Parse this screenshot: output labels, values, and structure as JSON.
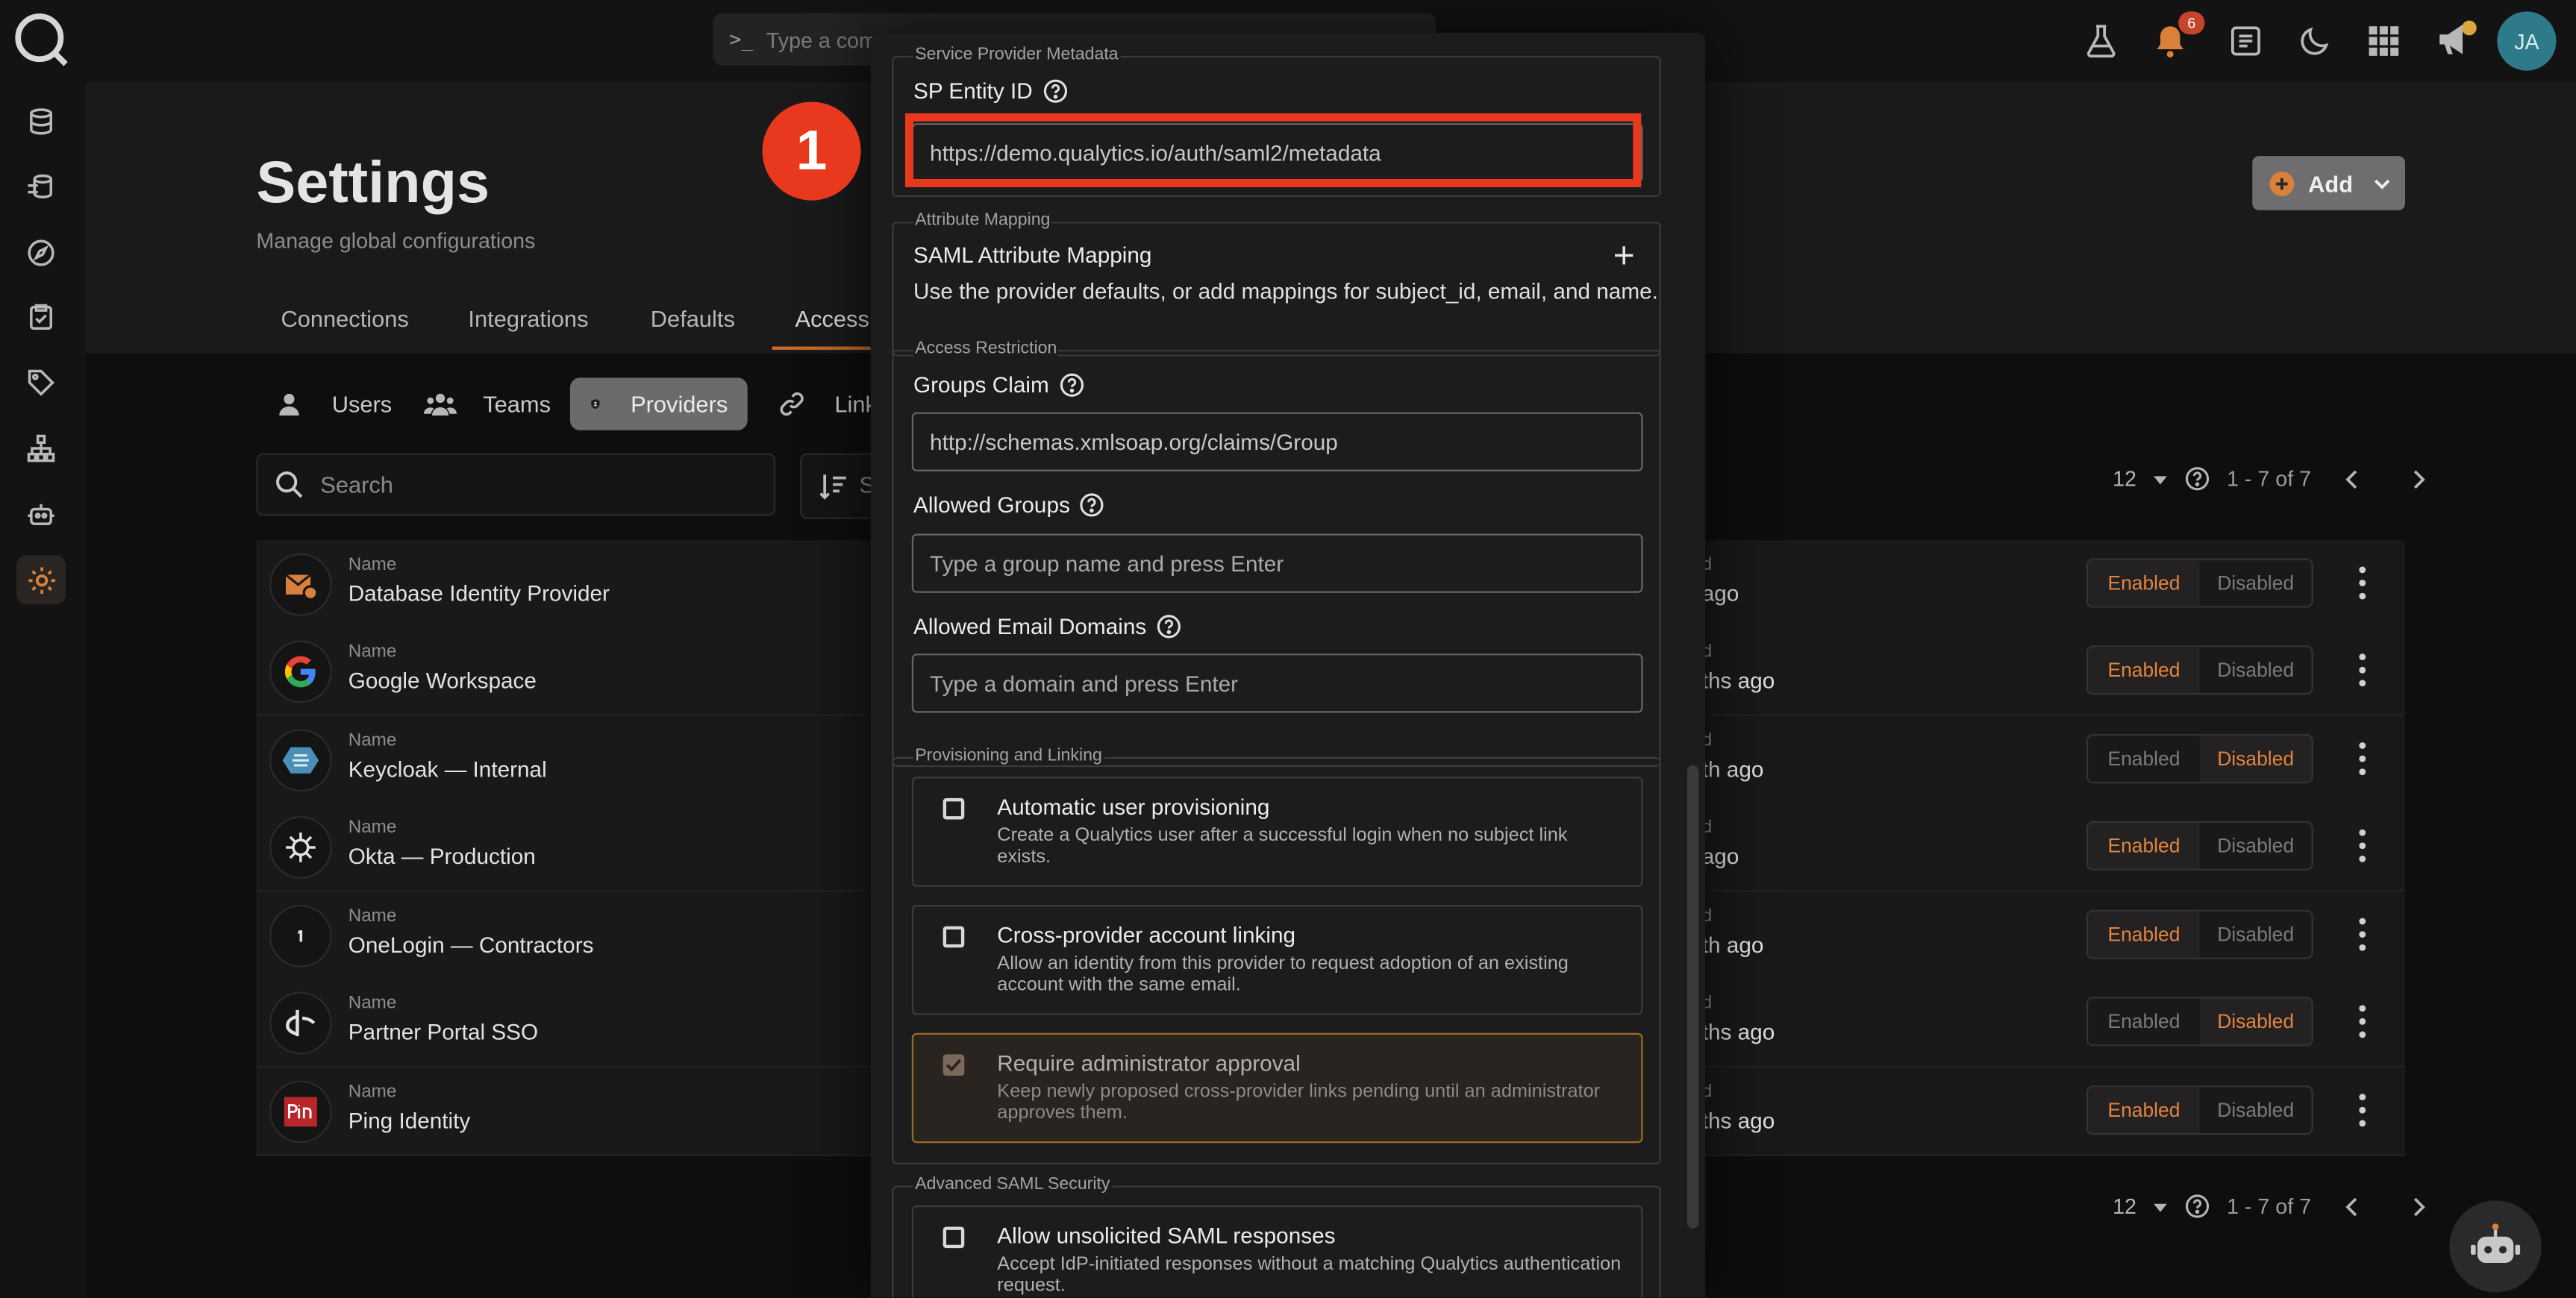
{
  "command_bar": {
    "placeholder": "Type a comm"
  },
  "header": {
    "title": "Settings",
    "subtitle": "Manage global configurations",
    "add_label": "Add",
    "notification_count": "6",
    "avatar_initials": "JA"
  },
  "tabs": [
    "Connections",
    "Integrations",
    "Defaults",
    "Access"
  ],
  "subtabs": [
    "Users",
    "Teams",
    "Providers",
    "Link"
  ],
  "sort_label": "S",
  "search": {
    "placeholder": "Search"
  },
  "pager": {
    "per_page": "12",
    "range": "1 - 7 of 7"
  },
  "providers": {
    "name_label": "Name",
    "updated_label": "d",
    "enabled_label": "Enabled",
    "disabled_label": "Disabled",
    "rows": [
      {
        "name": "Database Identity Provider",
        "updated": "ago",
        "state": "enabled"
      },
      {
        "name": "Google Workspace",
        "updated": "ths ago",
        "state": "enabled"
      },
      {
        "name": "Keycloak — Internal",
        "updated": "th ago",
        "state": "disabled"
      },
      {
        "name": "Okta — Production",
        "updated": "ago",
        "state": "enabled"
      },
      {
        "name": "OneLogin — Contractors",
        "updated": "th ago",
        "state": "enabled"
      },
      {
        "name": "Partner Portal SSO",
        "updated": "ths ago",
        "state": "disabled"
      },
      {
        "name": "Ping Identity",
        "updated": "ths ago",
        "state": "enabled"
      }
    ]
  },
  "modal": {
    "sp_metadata": {
      "legend": "Service Provider Metadata",
      "label": "SP Entity ID",
      "value": "https://demo.qualytics.io/auth/saml2/metadata"
    },
    "attribute_mapping": {
      "legend": "Attribute Mapping",
      "title": "SAML Attribute Mapping",
      "description": "Use the provider defaults, or add mappings for subject_id, email, and name."
    },
    "access_restriction": {
      "legend": "Access Restriction",
      "groups_claim_label": "Groups Claim",
      "groups_claim_value": "http://schemas.xmlsoap.org/claims/Group",
      "allowed_groups_label": "Allowed Groups",
      "allowed_groups_placeholder": "Type a group name and press Enter",
      "allowed_domains_label": "Allowed Email Domains",
      "allowed_domains_placeholder": "Type a domain and press Enter"
    },
    "provisioning": {
      "legend": "Provisioning and Linking",
      "auto_title": "Automatic user provisioning",
      "auto_desc": "Create a Qualytics user after a successful login when no subject link exists.",
      "linking_title": "Cross-provider account linking",
      "linking_desc": "Allow an identity from this provider to request adoption of an existing account with the same email.",
      "approval_title": "Require administrator approval",
      "approval_desc": "Keep newly proposed cross-provider links pending until an administrator approves them."
    },
    "advanced": {
      "legend": "Advanced SAML Security",
      "unsolicited_title": "Allow unsolicited SAML responses",
      "unsolicited_desc": "Accept IdP-initiated responses without a matching Qualytics authentication request."
    }
  },
  "annotation": {
    "step": "1",
    "color": "#e8391e"
  },
  "colors": {
    "accent": "#e0843f",
    "background": "#0f0f10"
  }
}
